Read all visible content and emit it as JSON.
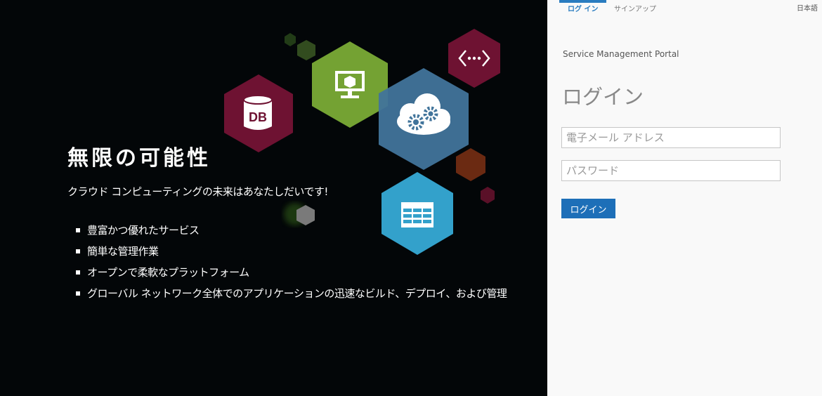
{
  "hero": {
    "title": "無限の可能性",
    "subtitle": "クラウド コンピューティングの未来はあなたしだいです!",
    "features": [
      "豊富かつ優れたサービス",
      "簡単な管理作業",
      "オープンで柔軟なプラットフォーム",
      "グローバル ネットワーク全体でのアプリケーションの迅速なビルド、デプロイ、および管理"
    ],
    "db_label": "DB",
    "colors": {
      "maroon": "#6e1232",
      "green": "#74a233",
      "steel_blue": "#41749b",
      "sky_blue": "#33a1cb",
      "brown": "#6b2a12"
    },
    "icons": [
      "database-icon",
      "monitor-cube-icon",
      "code-brackets-icon",
      "cloud-gears-icon",
      "table-grid-icon"
    ]
  },
  "panel": {
    "tabs": {
      "login": "ログ イン",
      "signup": "サインアップ"
    },
    "language": "日本語",
    "portal_name": "Service Management Portal",
    "heading": "ログイン",
    "email_placeholder": "電子メール アドレス",
    "password_placeholder": "パスワード",
    "login_button": "ログイン",
    "accent_color": "#1d6fb8"
  }
}
